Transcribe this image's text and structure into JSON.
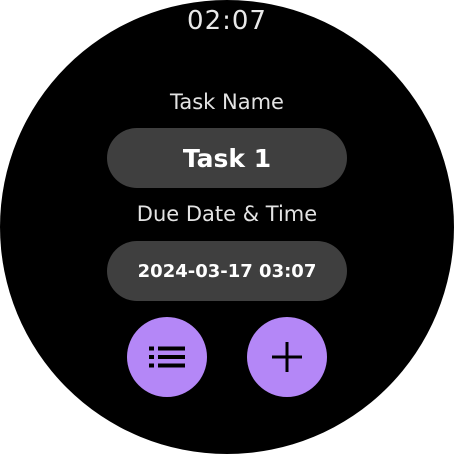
{
  "status": {
    "time": "02:07"
  },
  "form": {
    "task_name_label": "Task Name",
    "task_name_value": "Task 1",
    "due_label": "Due Date & Time",
    "due_value": "2024-03-17 03:07"
  },
  "actions": [
    {
      "icon": "list-icon"
    },
    {
      "icon": "plus-icon"
    }
  ],
  "colors": {
    "background": "#000000",
    "pill": "#3f3f3f",
    "accent": "#b487f7"
  }
}
